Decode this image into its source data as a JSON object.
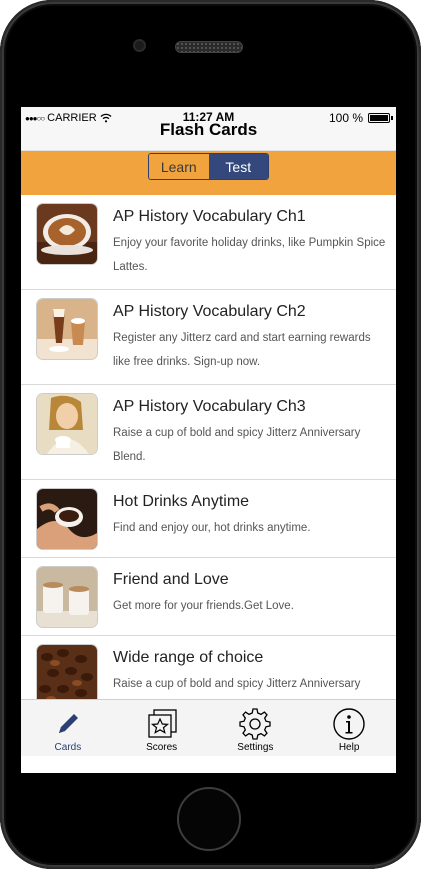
{
  "status_bar": {
    "signal": "●●●○○",
    "carrier": "CARRIER",
    "time": "11:27 AM",
    "battery": "100 %"
  },
  "nav": {
    "title": "Flash Cards"
  },
  "segmented": {
    "learn": "Learn",
    "test": "Test",
    "selected": "Test"
  },
  "list": [
    {
      "title": "AP History Vocabulary Ch1",
      "description": "Enjoy your favorite holiday drinks, like Pumpkin Spice Lattes.",
      "image": "latte-art-image"
    },
    {
      "title": "AP History Vocabulary Ch2",
      "description": "Register any Jitterz card and start earning rewards like free drinks. Sign-up now.",
      "image": "iced-drinks-image"
    },
    {
      "title": "AP History Vocabulary Ch3",
      "description": "Raise a cup of bold and spicy Jitterz Anniversary Blend.",
      "image": "woman-with-cup-image"
    },
    {
      "title": "Hot Drinks Anytime",
      "description": "Find and enjoy our, hot drinks anytime.",
      "image": "hands-holding-coffee-image"
    },
    {
      "title": "Friend and Love",
      "description": "Get more for your friends.Get Love.",
      "image": "two-mugs-image"
    },
    {
      "title": "Wide range of choice",
      "description": "Raise a cup of bold and spicy Jitterz Anniversary Blend.",
      "image": "coffee-beans-image"
    }
  ],
  "tabbar": {
    "cards": "Cards",
    "scores": "Scores",
    "settings": "Settings",
    "help": "Help",
    "active": "Cards"
  },
  "colors": {
    "accent_orange": "#f1a33d",
    "navy": "#34487d",
    "active_tab": "#2c3f73"
  }
}
